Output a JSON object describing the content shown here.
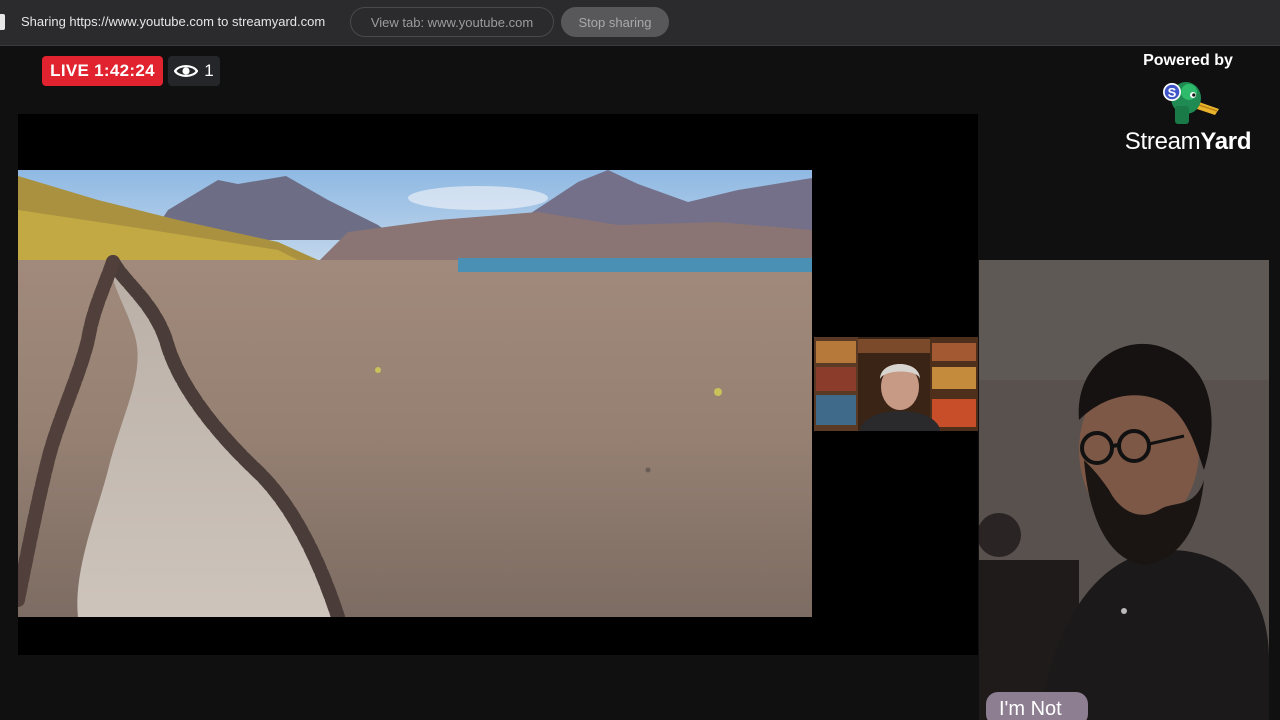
{
  "share_bar": {
    "sharing_text": "Sharing https://www.youtube.com to streamyard.com",
    "view_tab_label": "View tab: www.youtube.com",
    "stop_label": "Stop sharing"
  },
  "live": {
    "label": "LIVE 1:42:24",
    "viewers": "1",
    "badge_color": "#e0232e",
    "viewer_icon": "eye-icon"
  },
  "branding": {
    "powered_by": "Powered by",
    "logo_letter": "S",
    "wordmark_light": "Stream",
    "wordmark_bold": "Yard"
  },
  "host": {
    "name": "I'm Not"
  },
  "colors": {
    "background": "#101011",
    "share_bar": "#2b2b2d",
    "name_tag": "#8e7e92"
  }
}
